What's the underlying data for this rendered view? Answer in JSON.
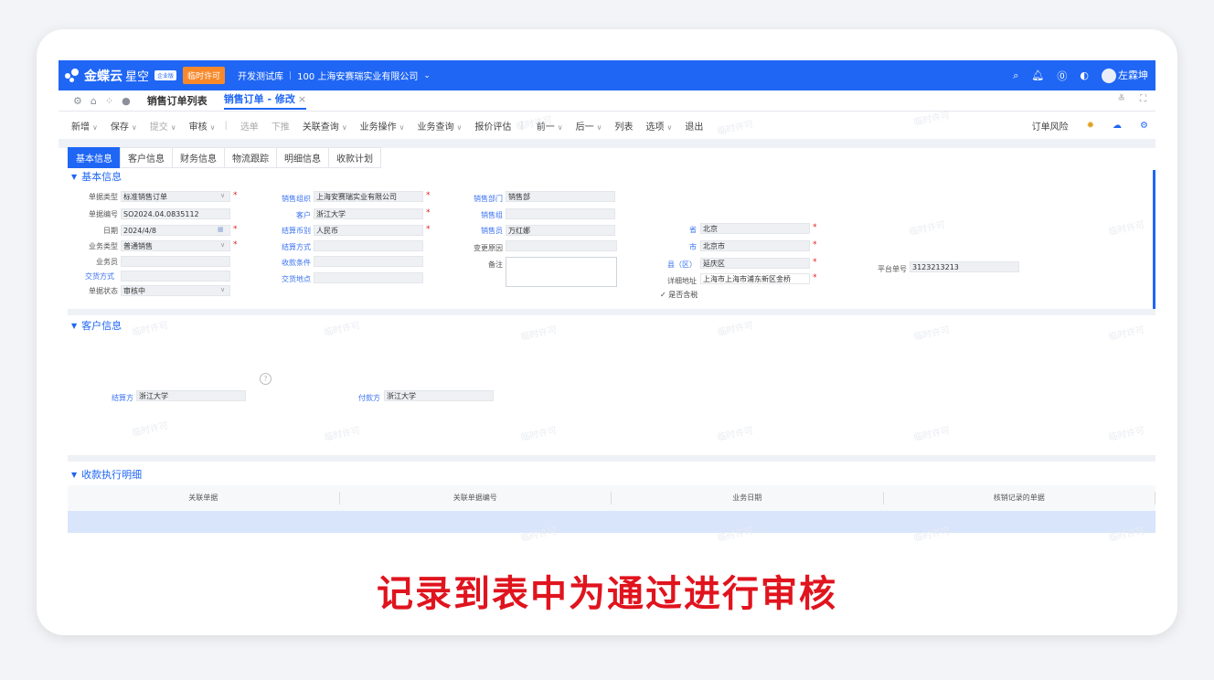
{
  "topbar": {
    "brand": "金蝶云",
    "brand_sub": "星空",
    "edition": "企业版",
    "temp_license": "临时许可",
    "db": "开发测试库",
    "company": "100 上海安赛瑞实业有限公司",
    "user": "左霖坤"
  },
  "tabs": {
    "list": "销售订单列表",
    "edit": "销售订单 - 修改",
    "close": "×"
  },
  "toolbar": {
    "items": [
      "新增",
      "保存",
      "提交",
      "审核",
      "选单",
      "下推",
      "关联查询",
      "业务操作",
      "业务查询",
      "报价评估",
      "前一",
      "后一",
      "列表",
      "选项",
      "退出"
    ],
    "right_label": "订单风险"
  },
  "subtabs": [
    "基本信息",
    "客户信息",
    "财务信息",
    "物流跟踪",
    "明细信息",
    "收款计划"
  ],
  "basic": {
    "title": "基本信息",
    "bill_type_label": "单据类型",
    "bill_type": "标准销售订单",
    "bill_no_label": "单据编号",
    "bill_no": "SO2024.04.0835112",
    "date_label": "日期",
    "date": "2024/4/8",
    "biz_type_label": "业务类型",
    "biz_type": "普通销售",
    "salesman_label": "业务员",
    "trade_label": "交货方式",
    "status_label": "单据状态",
    "status": "审核中",
    "sale_org_label": "销售组织",
    "sale_org": "上海安赛瑞实业有限公司",
    "customer_label": "客户",
    "customer": "浙江大学",
    "currency_label": "结算币别",
    "currency": "人民币",
    "settle_label": "结算方式",
    "terms_label": "收款条件",
    "place_label": "交货地点",
    "dept_label": "销售部门",
    "dept": "销售部",
    "group_label": "销售组",
    "seller_label": "销售员",
    "seller": "万红娜",
    "reason_label": "变更原因",
    "remark_label": "备注",
    "province_label": "省",
    "province": "北京",
    "city_label": "市",
    "city": "北京市",
    "county_label": "县（区）",
    "county": "延庆区",
    "addr_label": "详细地址",
    "addr": "上海市上海市浦东新区金桥",
    "tax_label": "是否含税",
    "platform_label": "平台单号",
    "platform": "3123213213"
  },
  "customer": {
    "title": "客户信息",
    "settle_party_label": "结算方",
    "settle_party": "浙江大学",
    "payer_label": "付款方",
    "payer": "浙江大学",
    "help": "?"
  },
  "receipt": {
    "title": "收款执行明细",
    "columns": [
      "关联单据",
      "关联单据编号",
      "业务日期",
      "核销记录的单据"
    ]
  },
  "caption": "记录到表中为通过进行审核",
  "watermark": "临时许可"
}
